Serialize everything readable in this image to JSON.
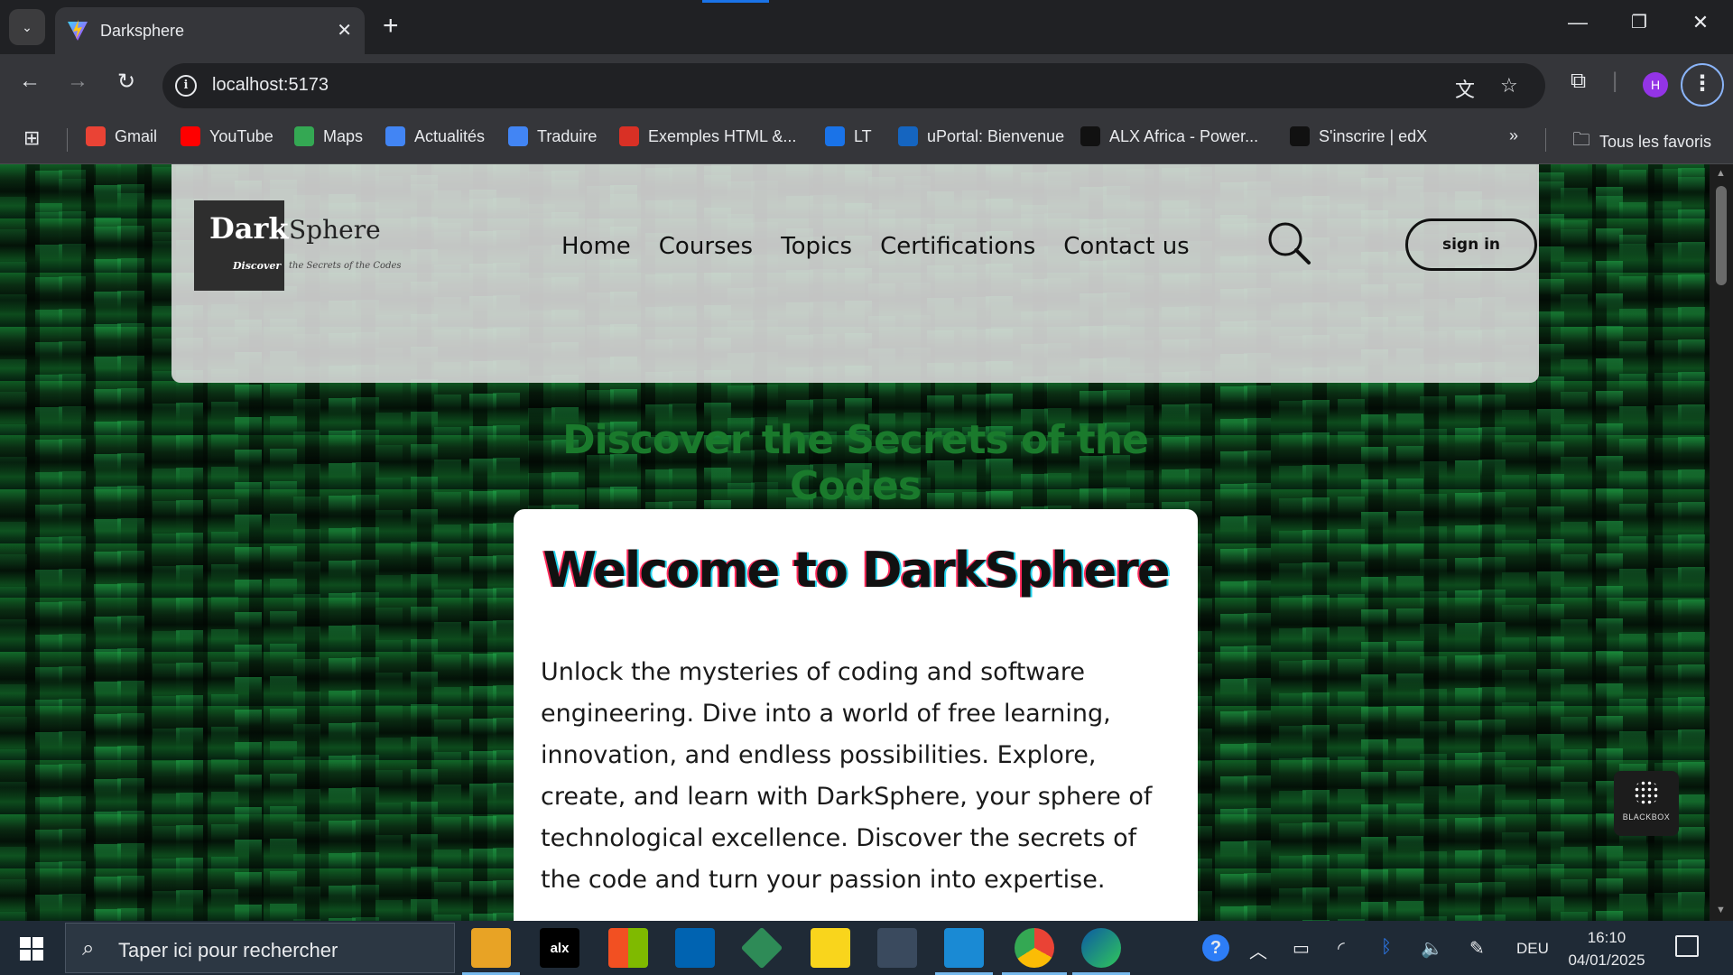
{
  "browser": {
    "tab_title": "Darksphere",
    "url": "localhost:5173",
    "avatar_letter": "H",
    "bookmarks": [
      {
        "label": "Gmail",
        "icon": "gmail-icon",
        "color": "#ea4335"
      },
      {
        "label": "YouTube",
        "icon": "youtube-icon",
        "color": "#ff0000"
      },
      {
        "label": "Maps",
        "icon": "maps-icon",
        "color": "#34a853"
      },
      {
        "label": "Actualités",
        "icon": "news-icon",
        "color": "#4285f4"
      },
      {
        "label": "Traduire",
        "icon": "translate-icon",
        "color": "#4285f4"
      },
      {
        "label": "Exemples HTML &...",
        "icon": "bookmark-icon",
        "color": "#d93025"
      },
      {
        "label": "LT",
        "icon": "bookmark-icon",
        "color": "#1a73e8"
      },
      {
        "label": "uPortal: Bienvenue",
        "icon": "uportal-icon",
        "color": "#1565c0"
      },
      {
        "label": "ALX Africa - Power...",
        "icon": "alx-icon",
        "color": "#111111"
      },
      {
        "label": "S'inscrire | edX",
        "icon": "edx-icon",
        "color": "#111111"
      }
    ],
    "all_bookmarks_label": "Tous les favoris"
  },
  "site": {
    "logo_dark": "Dark",
    "logo_sphere": "Sphere",
    "logo_discover": "Discover",
    "logo_tagline": "the Secrets of the Codes",
    "nav": [
      "Home",
      "Courses",
      "Topics",
      "Certifications",
      "Contact us"
    ],
    "signin_label": "sign in",
    "tagline": "Discover the Secrets of the Codes",
    "welcome_title": "Welcome to DarkSphere",
    "welcome_text": "Unlock the mysteries of coding and software engineering. Dive into a world of free learning, innovation, and endless possibilities. Explore, create, and learn with DarkSphere, your sphere of technological excellence. Discover the secrets of the code and turn your passion into expertise.",
    "accent_color": "#1a7a2c"
  },
  "widget": {
    "blackbox_label": "BLACKBOX"
  },
  "taskbar": {
    "search_placeholder": "Taper ici pour rechercher",
    "apps": [
      "file-explorer-icon",
      "alx-icon",
      "microsoft-store-icon",
      "window-app-icon",
      "git-icon",
      "sticky-notes-icon",
      "app-icon",
      "vscode-icon",
      "chrome-icon",
      "edge-icon"
    ],
    "alx_label": "alx",
    "language": "DEU",
    "time": "16:10",
    "date": "04/01/2025"
  }
}
